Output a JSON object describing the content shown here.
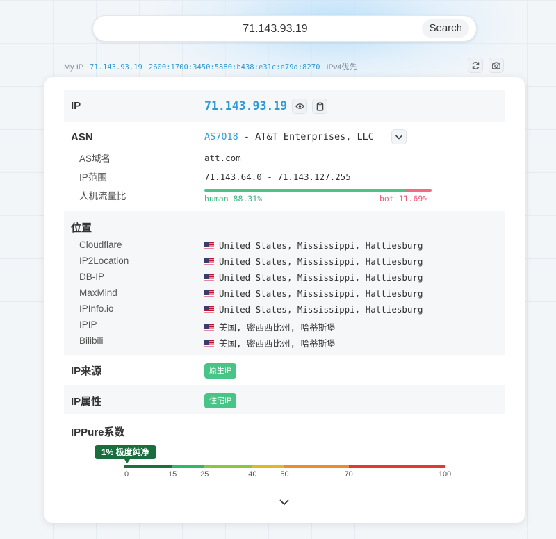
{
  "search": {
    "query": "71.143.93.19",
    "button_label": "Search"
  },
  "myip": {
    "label": "My IP",
    "ipv4": "71.143.93.19",
    "ipv6": "2600:1700:3450:5880:b438:e31c:e79d:8270",
    "preference": "IPv4优先"
  },
  "toolbar": {
    "refresh_icon": "refresh-icon",
    "camera_icon": "camera-icon"
  },
  "ip": {
    "label": "IP",
    "value": "71.143.93.19"
  },
  "asn": {
    "label": "ASN",
    "number": "AS7018",
    "separator": " - ",
    "org": "AT&T Enterprises, LLC",
    "domain_label": "AS域名",
    "domain": "att.com",
    "range_label": "IP范围",
    "range": "71.143.64.0 - 71.143.127.255",
    "traffic_label": "人机流量比",
    "human_text": "human 88.31%",
    "bot_text": "bot 11.69%",
    "human_pct": 88.31,
    "bot_pct": 11.69
  },
  "location": {
    "label": "位置",
    "sources": [
      {
        "name": "Cloudflare",
        "value": "United States, Mississippi, Hattiesburg"
      },
      {
        "name": "IP2Location",
        "value": "United States, Mississippi, Hattiesburg"
      },
      {
        "name": "DB-IP",
        "value": "United States, Mississippi, Hattiesburg"
      },
      {
        "name": "MaxMind",
        "value": "United States, Mississippi, Hattiesburg"
      },
      {
        "name": "IPInfo.io",
        "value": "United States, Mississippi, Hattiesburg"
      },
      {
        "name": "IPIP",
        "value": "美国, 密西西比州, 哈蒂斯堡"
      },
      {
        "name": "Bilibili",
        "value": "美国, 密西西比州, 哈蒂斯堡"
      }
    ]
  },
  "source": {
    "label": "IP来源",
    "tag": "原生IP"
  },
  "attribute": {
    "label": "IP属性",
    "tag": "住宅IP"
  },
  "ippure": {
    "label": "IPPure系数",
    "badge": "1% 极度纯净",
    "score": 1,
    "ticks": [
      "0",
      "15",
      "25",
      "40",
      "50",
      "70",
      "100"
    ],
    "tick_values": [
      0,
      15,
      25,
      40,
      50,
      70,
      100
    ],
    "segment_colors": [
      "#1c6e3c",
      "#2db86a",
      "#8cc63f",
      "#e0b820",
      "#ee8a2a",
      "#e23a32"
    ]
  },
  "colors": {
    "accent": "#2f9bd6",
    "tag_green": "#48c487",
    "human_green": "#4ec28a",
    "bot_red": "#f16b82"
  }
}
